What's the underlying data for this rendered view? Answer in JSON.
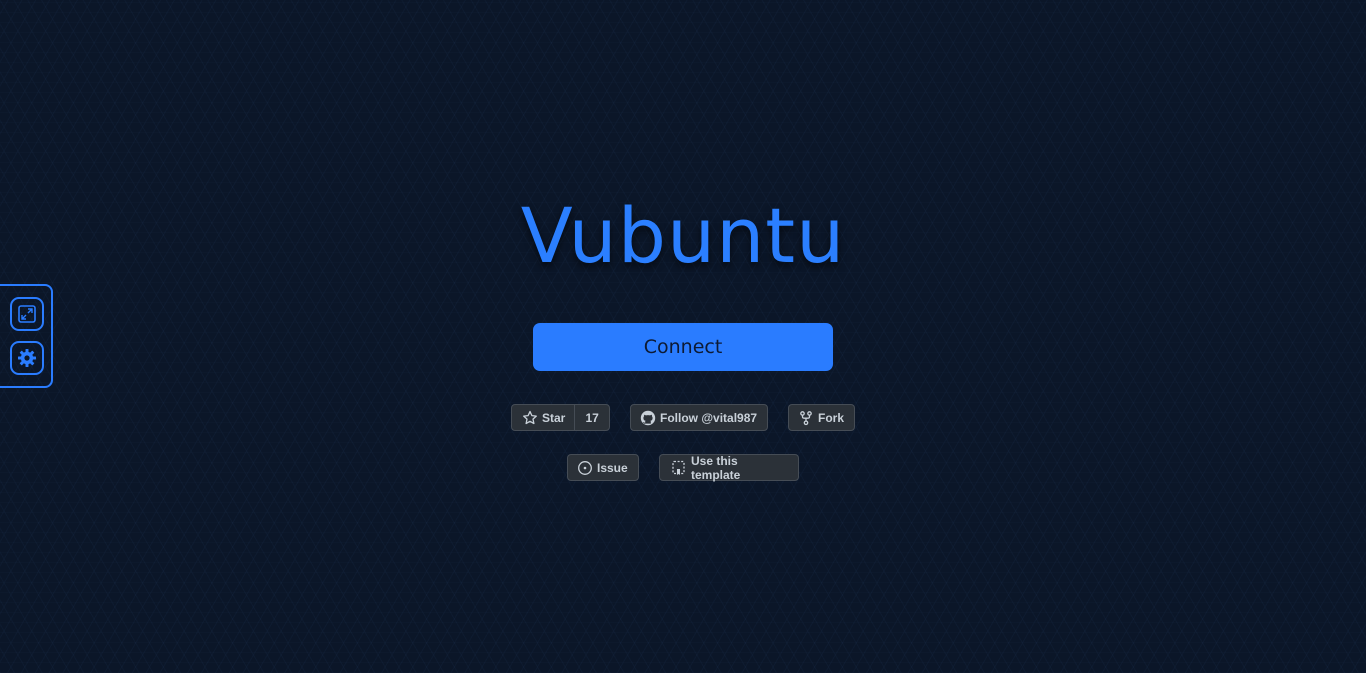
{
  "app": {
    "title": "Vubuntu"
  },
  "side_panel": {
    "buttons": [
      {
        "icon": "fullscreen-icon"
      },
      {
        "icon": "gear-icon"
      }
    ]
  },
  "main": {
    "connect_label": "Connect"
  },
  "github_buttons": {
    "star_label": "Star",
    "star_count": "17",
    "follow_label": "Follow @vital987",
    "fork_label": "Fork",
    "issue_label": "Issue",
    "template_label": "Use this template"
  },
  "colors": {
    "accent": "#2a7cff",
    "background": "#0b1628",
    "button_bg": "#2b3138",
    "button_text": "#c9d1d9"
  }
}
